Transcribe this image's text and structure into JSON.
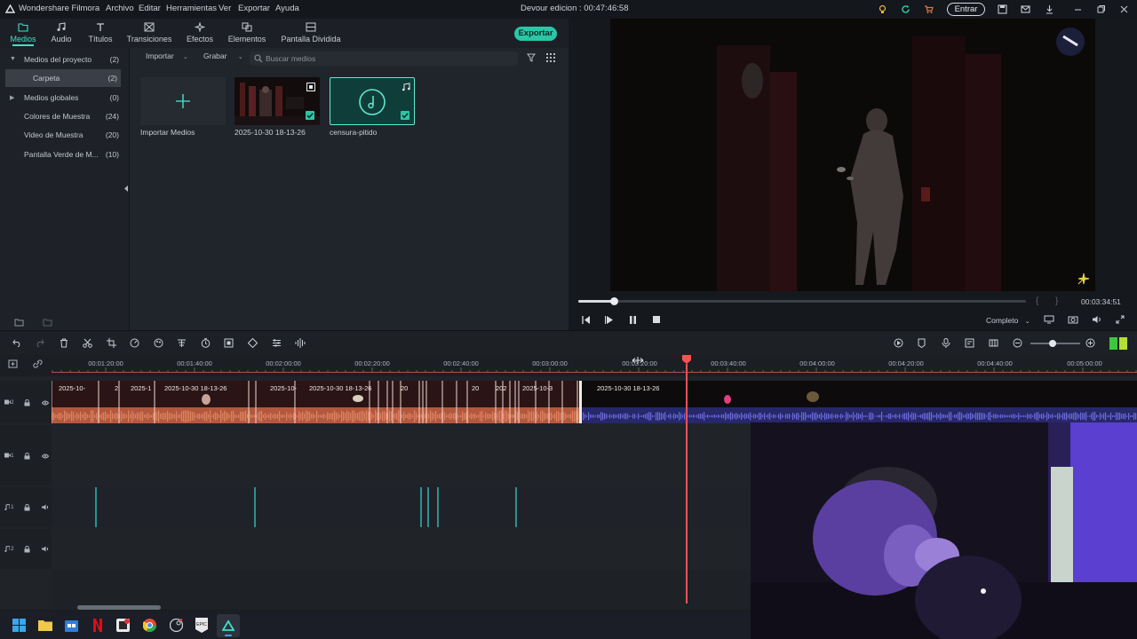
{
  "app": {
    "name": "Wondershare Filmora",
    "project_title": "Devour edicion : 00:47:46:58",
    "menu": [
      "Archivo",
      "Editar",
      "Herramientas",
      "Ver",
      "Exportar",
      "Ayuda"
    ],
    "login_label": "Entrar"
  },
  "tabs": [
    {
      "label": "Medios",
      "icon": "folder-icon",
      "active": true
    },
    {
      "label": "Audio",
      "icon": "music-icon",
      "active": false
    },
    {
      "label": "Títulos",
      "icon": "text-icon",
      "active": false
    },
    {
      "label": "Transiciones",
      "icon": "transition-icon",
      "active": false
    },
    {
      "label": "Efectos",
      "icon": "effects-icon",
      "active": false
    },
    {
      "label": "Elementos",
      "icon": "elements-icon",
      "active": false
    },
    {
      "label": "Pantalla Dividida",
      "icon": "split-screen-icon",
      "active": false
    }
  ],
  "export_label": "Exportar",
  "sidebar": {
    "items": [
      {
        "label": "Medios del proyecto",
        "count": "(2)",
        "expanded": true
      },
      {
        "label": "Carpeta",
        "count": "(2)",
        "selected": true
      },
      {
        "label": "Medios globales",
        "count": "(0)"
      },
      {
        "label": "Colores de Muestra",
        "count": "(24)"
      },
      {
        "label": "Video de Muestra",
        "count": "(20)"
      },
      {
        "label": "Pantalla Verde de M...",
        "count": "(10)"
      }
    ]
  },
  "media_toolbar": {
    "import_label": "Importar",
    "record_label": "Grabar",
    "search_placeholder": "Buscar medios"
  },
  "media_items": [
    {
      "caption": "Importar Medios",
      "kind": "import"
    },
    {
      "caption": "2025-10-30 18-13-26",
      "kind": "video",
      "checked": true
    },
    {
      "caption": "censura-pitido",
      "kind": "audio",
      "checked": true,
      "selected": true
    }
  ],
  "preview": {
    "timecode": "00:03:34:51",
    "quality": "Completo",
    "progress": 0.08
  },
  "ruler": {
    "timecodes": [
      "00:01:20:00",
      "00:01:40:00",
      "00:02:00:00",
      "00:02:20:00",
      "00:02:40:00",
      "00:03:00:00",
      "00:03:20:00",
      "00:03:40:00",
      "00:04:00:00",
      "00:04:20:00",
      "00:04:40:00",
      "00:05:00:00"
    ]
  },
  "tracks": {
    "video2": {
      "id": "2",
      "clips": [
        {
          "label": "2025-10-"
        },
        {
          "label": "2"
        },
        {
          "label": "2025-1"
        },
        {
          "label": "2025-10-30 18-13-26"
        },
        {
          "label": "2025-10-"
        },
        {
          "label": "2025-10-30 18-13-26"
        },
        {
          "label": "20"
        },
        {
          "label": "20"
        },
        {
          "label": "202"
        },
        {
          "label": "2025-10-3"
        },
        {
          "label": "2025-10-30 18-13-26"
        }
      ]
    },
    "video1": {
      "id": "1"
    },
    "audio1": {
      "id": "1"
    },
    "audio2": {
      "id": "2"
    }
  },
  "colors": {
    "accent": "#29c7a7",
    "playhead": "#ff5050",
    "clip_audio": "#c96a4a",
    "clip_audio_tail": "#5858c8"
  }
}
